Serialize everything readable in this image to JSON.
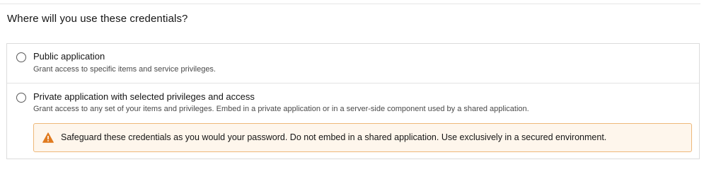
{
  "heading": "Where will you use these credentials?",
  "options": [
    {
      "title": "Public application",
      "description": "Grant access to specific items and service privileges.",
      "selected": false
    },
    {
      "title": "Private application with selected privileges and access",
      "description": "Grant access to any set of your items and privileges. Embed in a private application or in a server-side component used by a shared application.",
      "selected": false
    }
  ],
  "warning": {
    "icon": "warning-triangle-icon",
    "text": "Safeguard these credentials as you would your password. Do not embed in a shared application. Use exclusively in a secured environment.",
    "color": "#e07a1f"
  }
}
